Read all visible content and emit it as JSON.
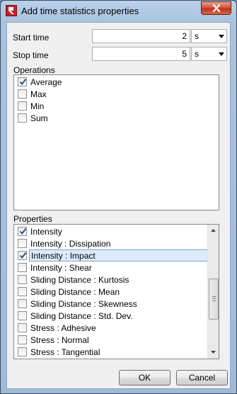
{
  "window": {
    "title": "Add time statistics properties"
  },
  "time": {
    "start_label": "Start time",
    "start_value": "2",
    "start_unit": "s",
    "stop_label": "Stop time",
    "stop_value": "5",
    "stop_unit": "s"
  },
  "operations": {
    "label": "Operations",
    "items": [
      {
        "label": "Average",
        "checked": true
      },
      {
        "label": "Max",
        "checked": false
      },
      {
        "label": "Min",
        "checked": false
      },
      {
        "label": "Sum",
        "checked": false
      }
    ]
  },
  "properties": {
    "label": "Properties",
    "items": [
      {
        "label": "Intensity",
        "checked": true,
        "selected": false
      },
      {
        "label": "Intensity : Dissipation",
        "checked": false,
        "selected": false
      },
      {
        "label": "Intensity : Impact",
        "checked": true,
        "selected": true
      },
      {
        "label": "Intensity : Shear",
        "checked": false,
        "selected": false
      },
      {
        "label": "Sliding Distance : Kurtosis",
        "checked": false,
        "selected": false
      },
      {
        "label": "Sliding Distance : Mean",
        "checked": false,
        "selected": false
      },
      {
        "label": "Sliding Distance : Skewness",
        "checked": false,
        "selected": false
      },
      {
        "label": "Sliding Distance : Std. Dev.",
        "checked": false,
        "selected": false
      },
      {
        "label": "Stress : Adhesive",
        "checked": false,
        "selected": false
      },
      {
        "label": "Stress : Normal",
        "checked": false,
        "selected": false
      },
      {
        "label": "Stress : Tangential",
        "checked": false,
        "selected": false
      }
    ]
  },
  "buttons": {
    "ok": "OK",
    "cancel": "Cancel"
  },
  "colors": {
    "close_button": "#c7452b",
    "selection": "#dcebfc",
    "checkmark": "#2a4f8c"
  },
  "icons": {
    "app": "app-logo-icon",
    "close": "close-icon",
    "check": "check-icon"
  }
}
